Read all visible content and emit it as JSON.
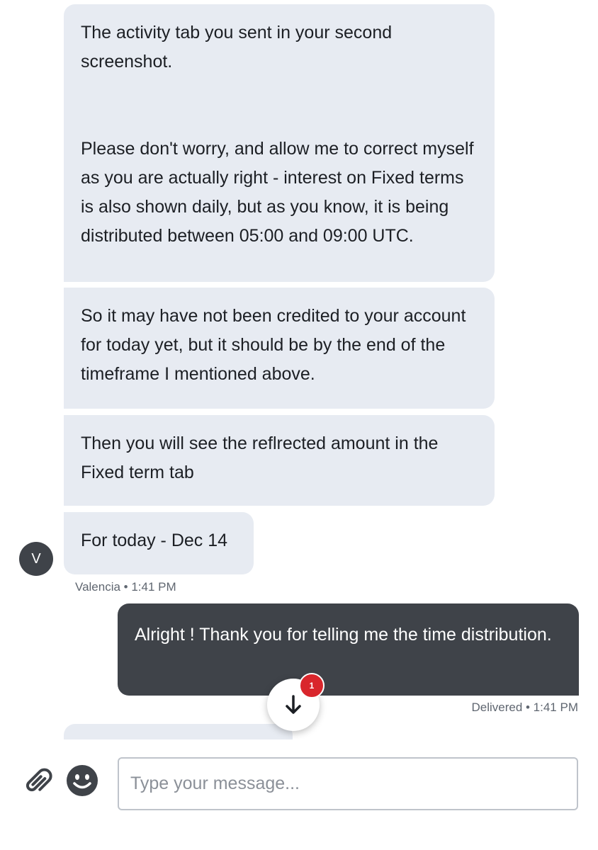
{
  "messages": {
    "incoming": [
      {
        "text": "The activity tab you sent in your second screenshot.\n\n\nPlease don't worry, and allow me to correct myself as you are actually right - interest on Fixed terms is also shown daily, but as you know, it is being distributed between 05:00 and 09:00 UTC."
      },
      {
        "text": "So it may have not been credited to your account for today yet, but it should be by the end of the timeframe I mentioned above."
      },
      {
        "text": "Then you will see the reflrected amount in the Fixed term tab"
      },
      {
        "text": "For today - Dec 14"
      }
    ],
    "agent_initial": "V",
    "incoming_meta": "Valencia • 1:41 PM",
    "outgoing": {
      "text": "Alright ! Thank you for telling me the time distribution.",
      "meta": "Delivered • 1:41 PM"
    }
  },
  "scroll_button": {
    "icon": "arrow-down-icon",
    "badge_count": "1"
  },
  "composer": {
    "attach_icon": "paperclip-icon",
    "emoji_icon": "smiley-icon",
    "placeholder": "Type your message..."
  },
  "colors": {
    "incoming_bubble": "#e7ebf2",
    "outgoing_bubble": "#3f4349",
    "badge": "#d9262c"
  }
}
